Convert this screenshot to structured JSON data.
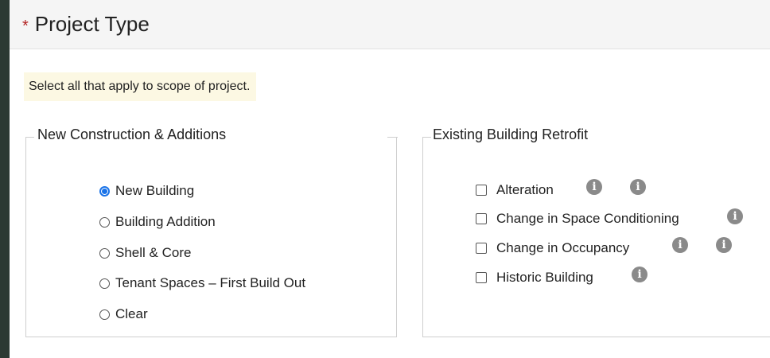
{
  "header": {
    "required_marker": "*",
    "title": "Project Type"
  },
  "hint": "Select all that apply to scope of project.",
  "new_construction": {
    "legend": "New Construction & Additions",
    "options": [
      {
        "label": "New Building",
        "selected": true
      },
      {
        "label": "Building Addition",
        "selected": false
      },
      {
        "label": "Shell & Core",
        "selected": false
      },
      {
        "label": "Tenant Spaces – First Build Out",
        "selected": false
      },
      {
        "label": "Clear",
        "selected": false
      }
    ]
  },
  "existing_retrofit": {
    "legend": "Existing Building Retrofit",
    "options": [
      {
        "label": "Alteration",
        "checked": false,
        "info_icons": 2
      },
      {
        "label": "Change in Space Conditioning",
        "checked": false,
        "info_icons": 1
      },
      {
        "label": "Change in Occupancy",
        "checked": false,
        "info_icons": 2
      },
      {
        "label": "Historic Building",
        "checked": false,
        "info_icons": 1
      }
    ]
  },
  "icons": {
    "info": "i",
    "info_color": "#8a8a8a",
    "accent": "#1a73e8"
  }
}
